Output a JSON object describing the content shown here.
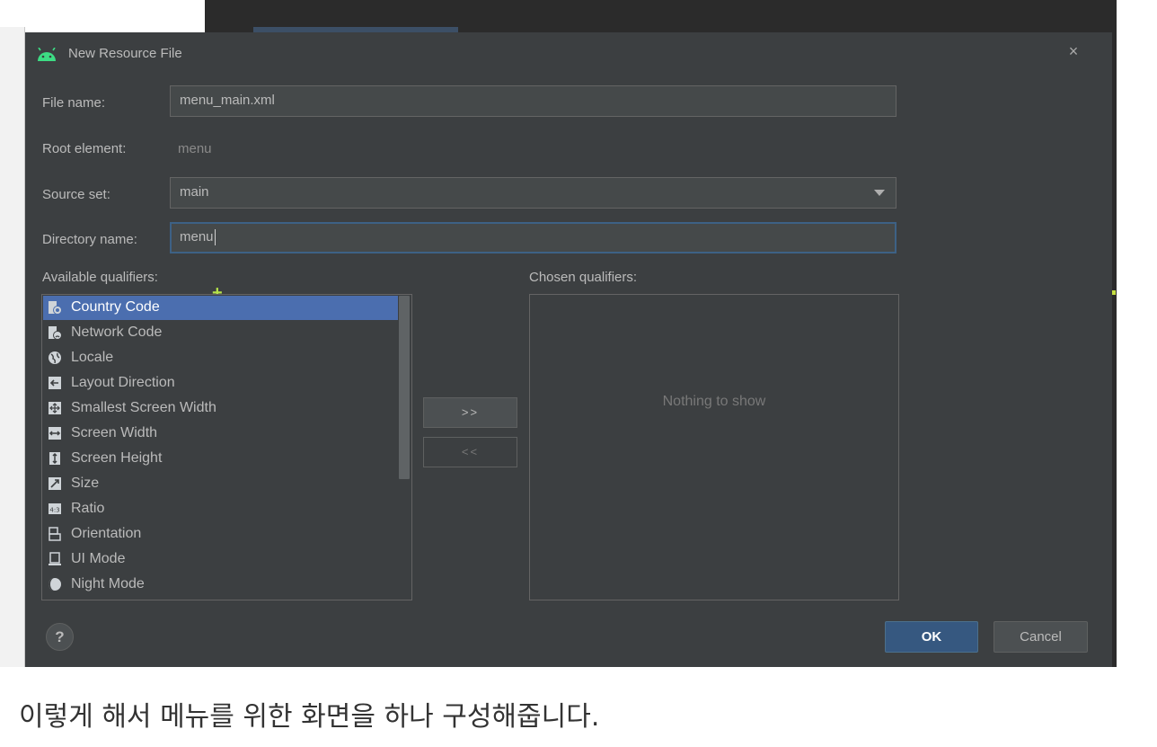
{
  "dialog": {
    "title": "New Resource File",
    "close_symbol": "×",
    "icon": "android-icon"
  },
  "form": {
    "file_name_label": "File name:",
    "file_name_value": "menu_main.xml",
    "root_element_label": "Root element:",
    "root_element_value": "menu",
    "source_set_label": "Source set:",
    "source_set_value": "main",
    "directory_name_label": "Directory name:",
    "directory_name_value": "menu"
  },
  "qualifiers": {
    "available_label": "Available qualifiers:",
    "chosen_label": "Chosen qualifiers:",
    "available_items": [
      {
        "label": "Country Code",
        "icon": "country-code-icon",
        "selected": true
      },
      {
        "label": "Network Code",
        "icon": "network-code-icon"
      },
      {
        "label": "Locale",
        "icon": "locale-globe-icon"
      },
      {
        "label": "Layout Direction",
        "icon": "layout-direction-icon"
      },
      {
        "label": "Smallest Screen Width",
        "icon": "smallest-screen-width-icon"
      },
      {
        "label": "Screen Width",
        "icon": "screen-width-icon"
      },
      {
        "label": "Screen Height",
        "icon": "screen-height-icon"
      },
      {
        "label": "Size",
        "icon": "size-icon"
      },
      {
        "label": "Ratio",
        "icon": "ratio-icon"
      },
      {
        "label": "Orientation",
        "icon": "orientation-icon"
      },
      {
        "label": "UI Mode",
        "icon": "ui-mode-icon"
      },
      {
        "label": "Night Mode",
        "icon": "night-mode-icon"
      }
    ],
    "add_button_label": ">>",
    "remove_button_label": "<<",
    "empty_text": "Nothing to show"
  },
  "footer": {
    "help_label": "?",
    "ok_label": "OK",
    "cancel_label": "Cancel"
  },
  "caption": "이렇게 해서 메뉴를 위한 화면을 하나 구성해줍니다.",
  "colors": {
    "dialog_bg": "#3c3f41",
    "selection": "#4b6eaf",
    "ok_button": "#365880",
    "android_green": "#3ddc84"
  }
}
